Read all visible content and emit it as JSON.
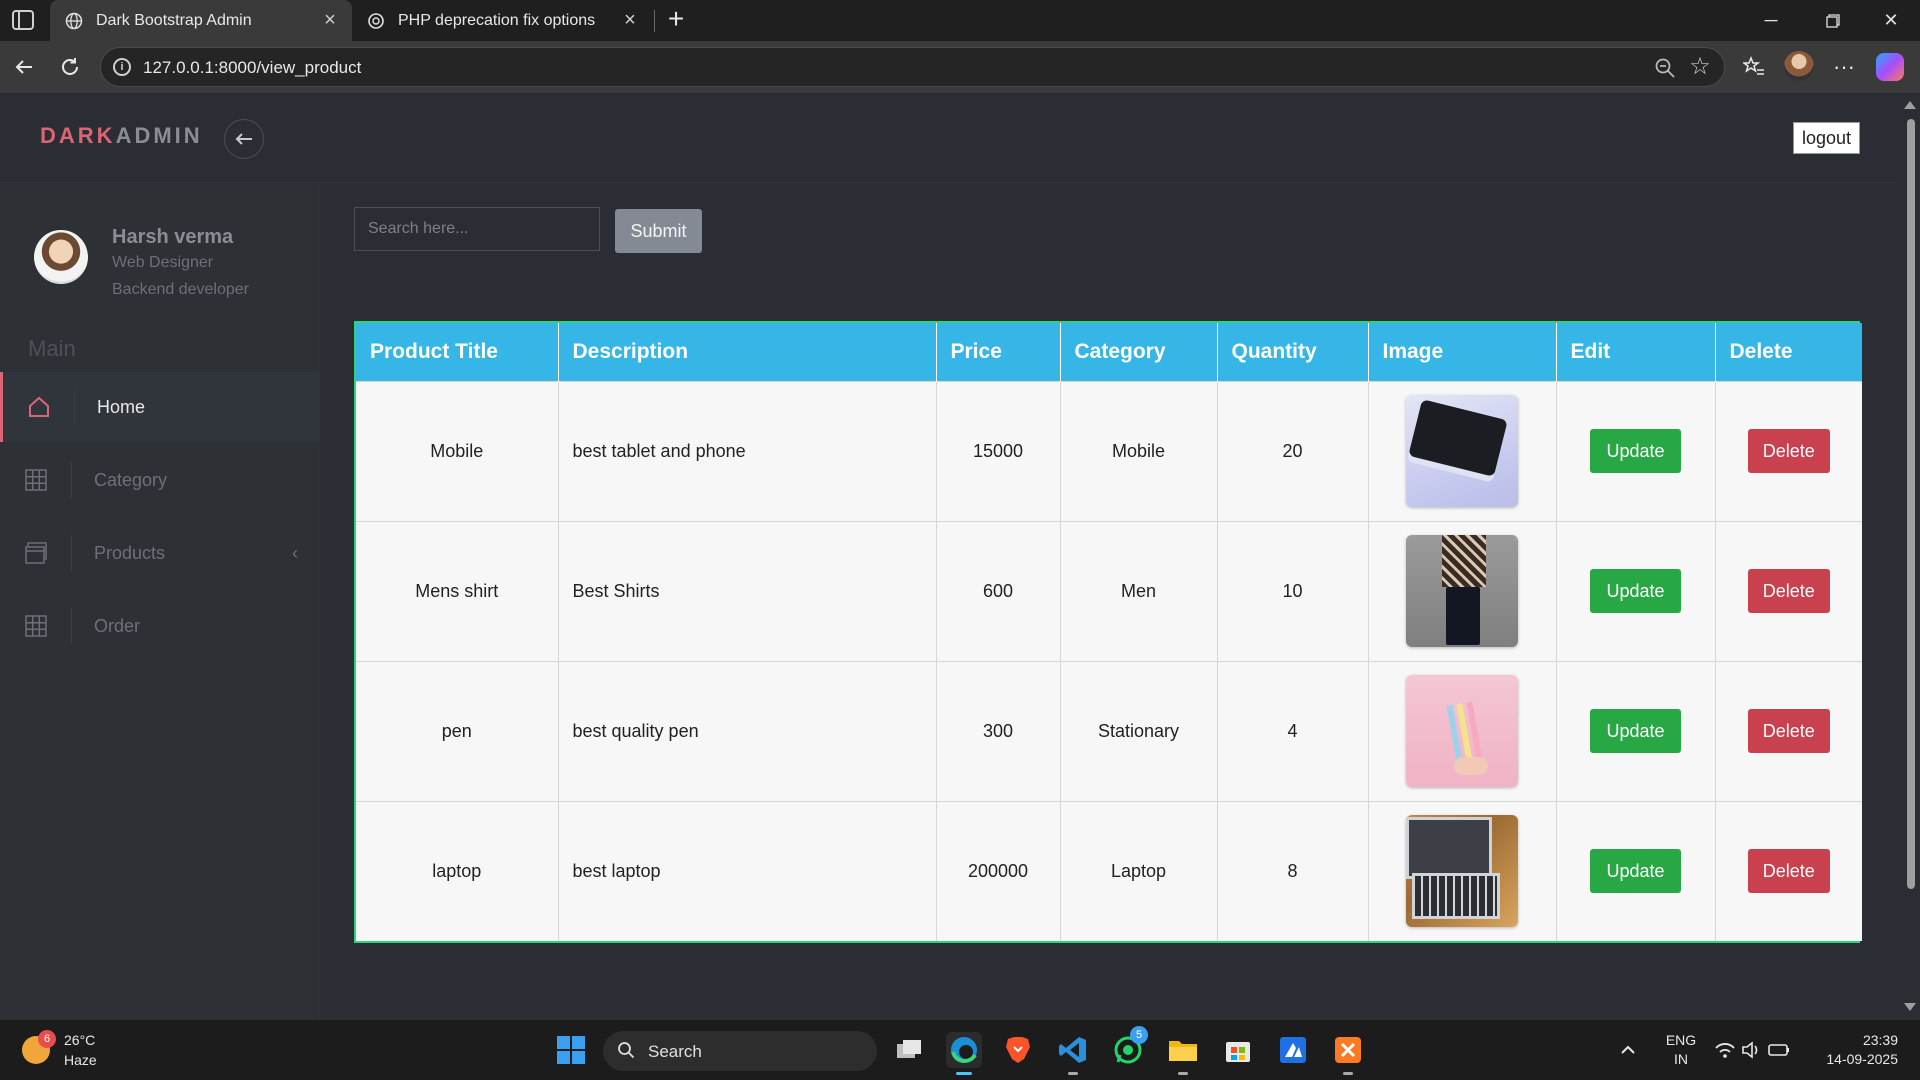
{
  "browser": {
    "tabs": [
      {
        "title": "Dark Bootstrap Admin",
        "active": true
      },
      {
        "title": "PHP deprecation fix options",
        "active": false
      }
    ],
    "url": "127.0.0.1:8000/view_product"
  },
  "header": {
    "brand_dark": "DARK",
    "brand_admin": "ADMIN",
    "logout_label": "logout"
  },
  "sidebar": {
    "user": {
      "name": "Harsh verma",
      "role1": "Web Designer",
      "role2": "Backend developer"
    },
    "section_label": "Main",
    "items": [
      {
        "label": "Home",
        "icon": "home-icon",
        "active": true
      },
      {
        "label": "Category",
        "icon": "grid-icon",
        "active": false
      },
      {
        "label": "Products",
        "icon": "window-icon",
        "active": false,
        "chevron": "‹"
      },
      {
        "label": "Order",
        "icon": "grid-icon",
        "active": false
      }
    ]
  },
  "search": {
    "placeholder": "Search here...",
    "submit_label": "Submit"
  },
  "table": {
    "headers": [
      "Product Title",
      "Description",
      "Price",
      "Category",
      "Quantity",
      "Image",
      "Edit",
      "Delete"
    ],
    "rows": [
      {
        "title": "Mobile",
        "description": "best tablet and phone",
        "price": "15000",
        "category": "Mobile",
        "quantity": "20",
        "image": "tablet-image",
        "edit": "Update",
        "delete": "Delete"
      },
      {
        "title": "Mens shirt",
        "description": "Best Shirts",
        "price": "600",
        "category": "Men",
        "quantity": "10",
        "image": "shirt-image",
        "edit": "Update",
        "delete": "Delete"
      },
      {
        "title": "pen",
        "description": "best quality pen",
        "price": "300",
        "category": "Stationary",
        "quantity": "4",
        "image": "pen-image",
        "edit": "Update",
        "delete": "Delete"
      },
      {
        "title": "laptop",
        "description": "best laptop",
        "price": "200000",
        "category": "Laptop",
        "quantity": "8",
        "image": "laptop-image",
        "edit": "Update",
        "delete": "Delete"
      }
    ]
  },
  "taskbar": {
    "weather_badge": "6",
    "temperature": "26°C",
    "condition": "Haze",
    "search_label": "Search",
    "whatsapp_badge": "5",
    "language": "ENG",
    "region": "IN",
    "time": "23:39",
    "date": "14-09-2025"
  },
  "colors": {
    "accent": "#db6574",
    "table_header": "#35b6e6",
    "table_border": "#2bd67b",
    "update": "#28a745",
    "delete": "#c9404f"
  }
}
